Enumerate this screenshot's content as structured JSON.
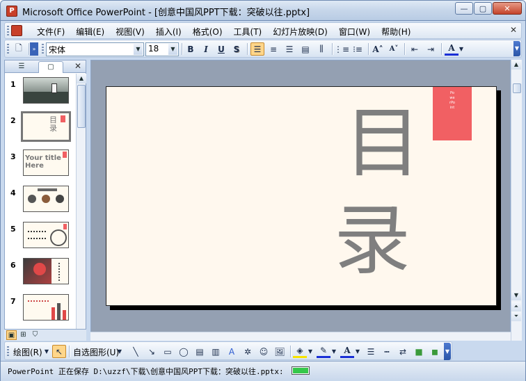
{
  "window": {
    "title": "Microsoft Office PowerPoint - [创意中国风PPT下载：突破以往.pptx]",
    "minimize_symbol": "—",
    "maximize_symbol": "▢",
    "close_symbol": "✕"
  },
  "menubar": {
    "items": [
      "文件(F)",
      "编辑(E)",
      "视图(V)",
      "插入(I)",
      "格式(O)",
      "工具(T)",
      "幻灯片放映(D)",
      "窗口(W)",
      "帮助(H)"
    ],
    "close_symbol": "✕"
  },
  "toolbar": {
    "font_name": "宋体",
    "font_size": "18",
    "bold": "B",
    "italic": "I",
    "underline": "U",
    "shadow": "S",
    "align_left_active": true
  },
  "pane": {
    "close_symbol": "✕",
    "thumbnails": [
      {
        "num": "1",
        "kind": "landscape"
      },
      {
        "num": "2",
        "kind": "title",
        "text": "目录",
        "selected": true
      },
      {
        "num": "3",
        "kind": "text",
        "text": "Your title Here"
      },
      {
        "num": "4",
        "kind": "circles"
      },
      {
        "num": "5",
        "kind": "icons"
      },
      {
        "num": "6",
        "kind": "person"
      },
      {
        "num": "7",
        "kind": "bars"
      }
    ]
  },
  "slide": {
    "char1": "目",
    "char2": "录",
    "tab_text": "PowerPoint",
    "background": "#fff8ee",
    "tab_color": "#f16063",
    "char_color": "#7f7f7f"
  },
  "drawbar": {
    "draw_label": "绘图(R)",
    "autoshape_label": "自选图形(U)"
  },
  "status": {
    "text": "PowerPoint 正在保存 D:\\uzzf\\下载\\创意中国风PPT下载：突破以往.pptx:",
    "progress": 1.0
  }
}
